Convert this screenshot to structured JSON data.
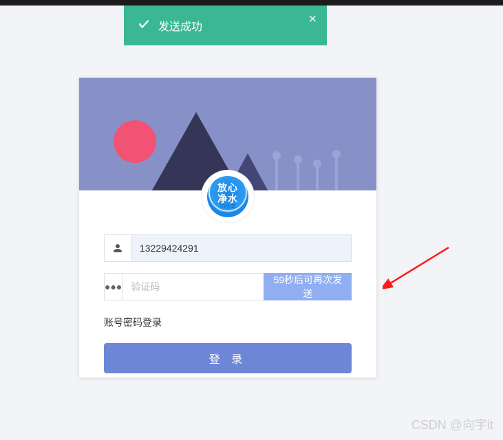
{
  "toast": {
    "message": "发送成功"
  },
  "logo": {
    "line1": "放心",
    "line2": "净水",
    "sub": "10周年"
  },
  "form": {
    "phone_value": "13229424291",
    "code_placeholder": "验证码",
    "send_countdown_label": "59秒后可再次发送",
    "password_login_link": "账号密码登录",
    "login_button": "登 录"
  },
  "watermark": "CSDN @向宇it"
}
